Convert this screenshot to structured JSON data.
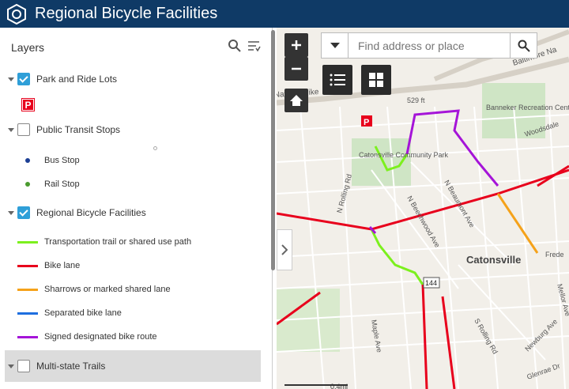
{
  "app": {
    "title": "Regional Bicycle Facilities"
  },
  "panel": {
    "title": "Layers"
  },
  "layers": {
    "park_ride": "Park and Ride Lots",
    "transit": "Public Transit Stops",
    "bus_stop": "Bus Stop",
    "rail_stop": "Rail Stop",
    "bike": "Regional Bicycle Facilities",
    "multistate": "Multi-state Trails"
  },
  "legend": {
    "trail": "Transportation trail or shared use path",
    "bike_lane": "Bike lane",
    "sharrows": "Sharrows or marked shared lane",
    "separated": "Separated bike lane",
    "signed": "Signed designated bike route"
  },
  "search": {
    "placeholder": "Find address or place"
  },
  "map": {
    "labels": {
      "baltimore": "Baltimore Na",
      "national_pike": "Nationa Pike",
      "ft529": "529 ft",
      "banneker": "Banneker Recreation Center",
      "catonsville_park": "Catonsville Community Park",
      "catonsville": "Catonsville",
      "woodsdale": "Woodsdale",
      "beaumont": "N Beaumont Ave",
      "beechwood": "N Beechwood Ave",
      "rolling": "N Rolling Rd",
      "srolling": "S Rolling Rd",
      "maple": "Maple Ave",
      "mellor": "Mellor Ave",
      "newburg": "Newburg Ave",
      "glenrae": "Glenrae Dr",
      "route144": "144",
      "scale": "0.4mi",
      "frederick": "Frede"
    }
  },
  "colors": {
    "trail": "#7cf01e",
    "bike_lane": "#e8001c",
    "sharrows": "#f5a21a",
    "separated": "#1e6fe0",
    "signed": "#a514d8"
  }
}
